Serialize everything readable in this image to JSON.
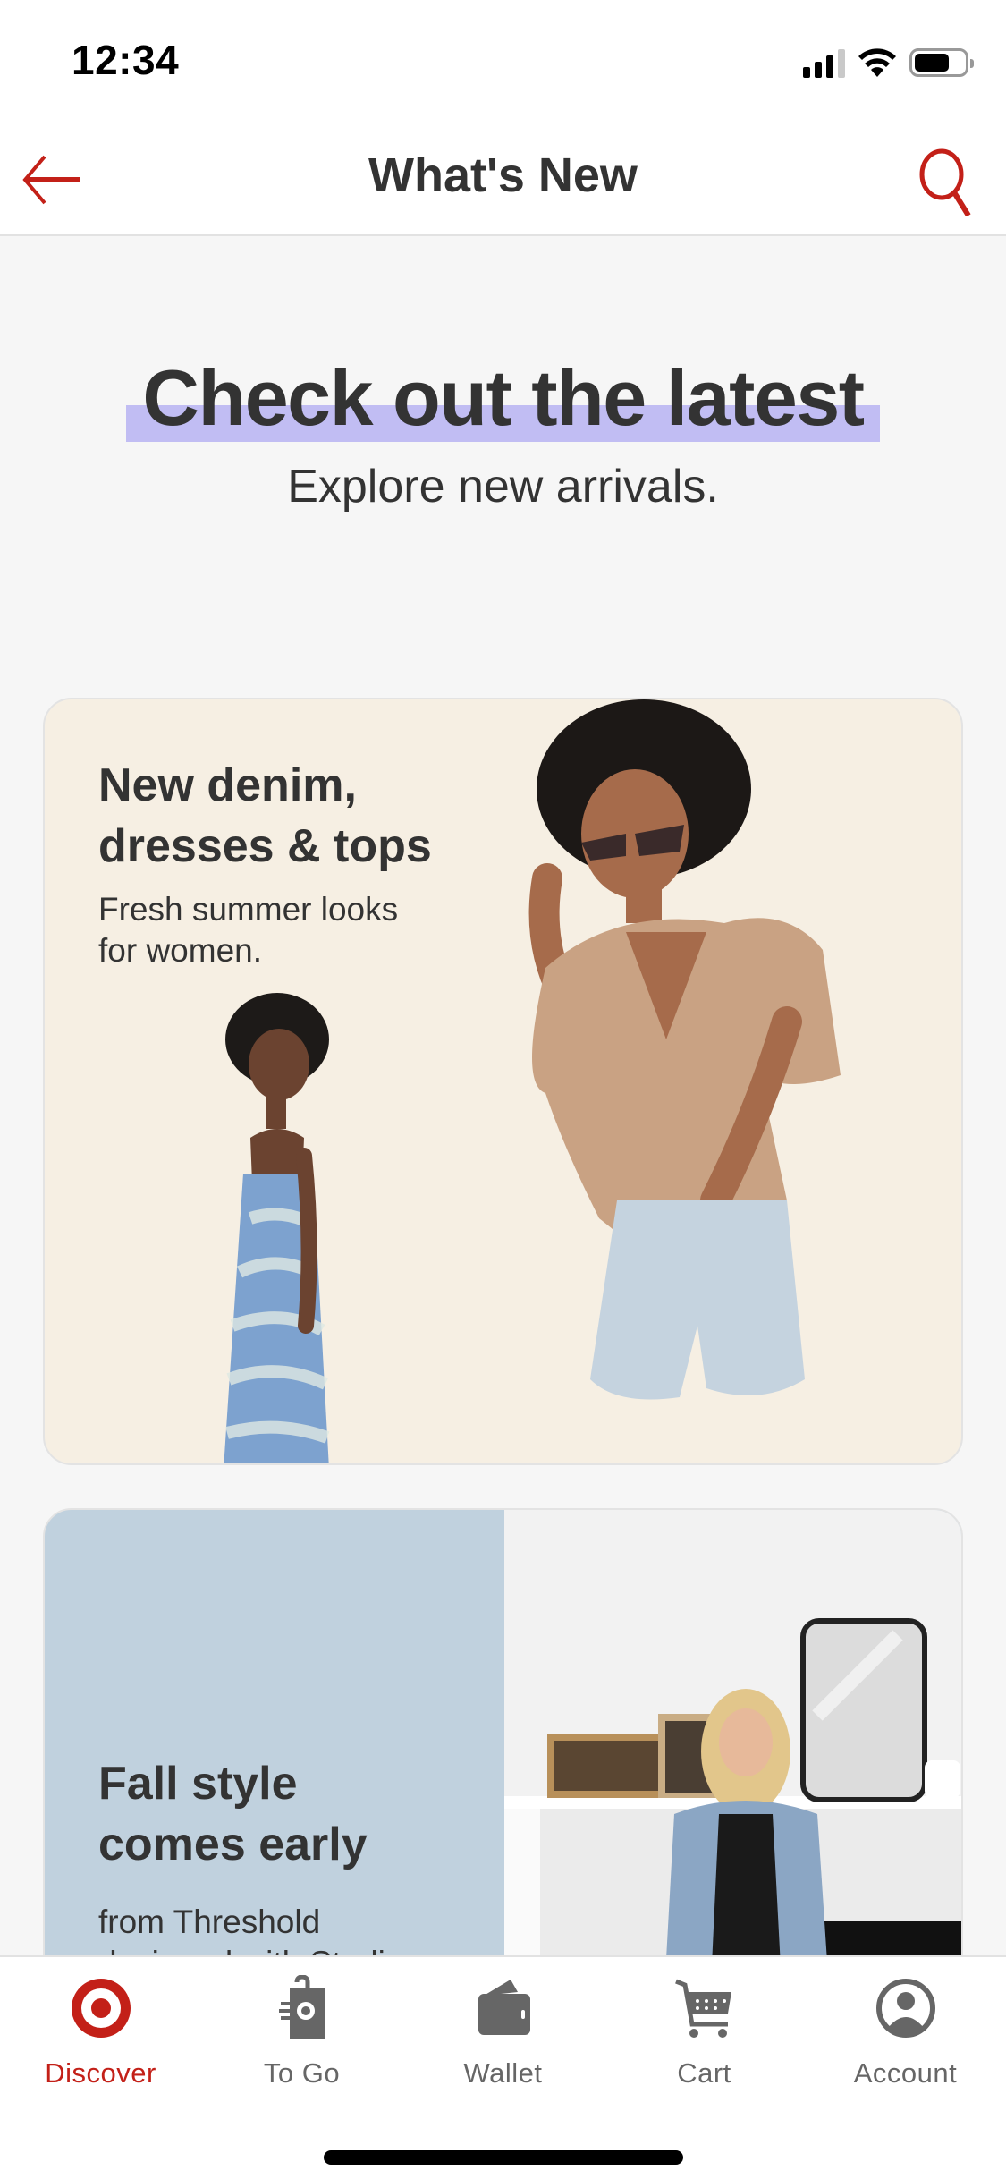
{
  "status_bar": {
    "time": "12:34",
    "icons": [
      "cellular-signal-icon",
      "wifi-icon",
      "battery-icon"
    ]
  },
  "header": {
    "title": "What's New",
    "back_icon": "arrow-left-icon",
    "search_icon": "search-icon"
  },
  "hero": {
    "title": "Check out the latest",
    "subtitle": "Explore new arrivals.",
    "highlight_color": "#c1bdf3"
  },
  "cards": [
    {
      "heading_lines": [
        "New denim,",
        "dresses & tops"
      ],
      "body_lines": [
        "Fresh summer looks",
        "for women."
      ],
      "background": "#f6efe3",
      "images": [
        "woman-in-tie-dye-dress",
        "woman-in-satin-tie-top-and-denim-shorts"
      ]
    },
    {
      "heading_lines": [
        "Fall style",
        "comes early"
      ],
      "body_lines": [
        "from Threshold",
        "designed with Studio"
      ],
      "background": "#c0d1de",
      "images": [
        "woman-in-denim-jacket-by-fireplace"
      ]
    }
  ],
  "tab_bar": {
    "active_color": "#c32018",
    "inactive_color": "#666666",
    "tabs": [
      {
        "label": "Discover",
        "icon": "target-bullseye-icon",
        "active": true
      },
      {
        "label": "To Go",
        "icon": "shopping-bag-icon",
        "active": false
      },
      {
        "label": "Wallet",
        "icon": "wallet-icon",
        "active": false
      },
      {
        "label": "Cart",
        "icon": "cart-icon",
        "active": false
      },
      {
        "label": "Account",
        "icon": "account-icon",
        "active": false
      }
    ]
  }
}
